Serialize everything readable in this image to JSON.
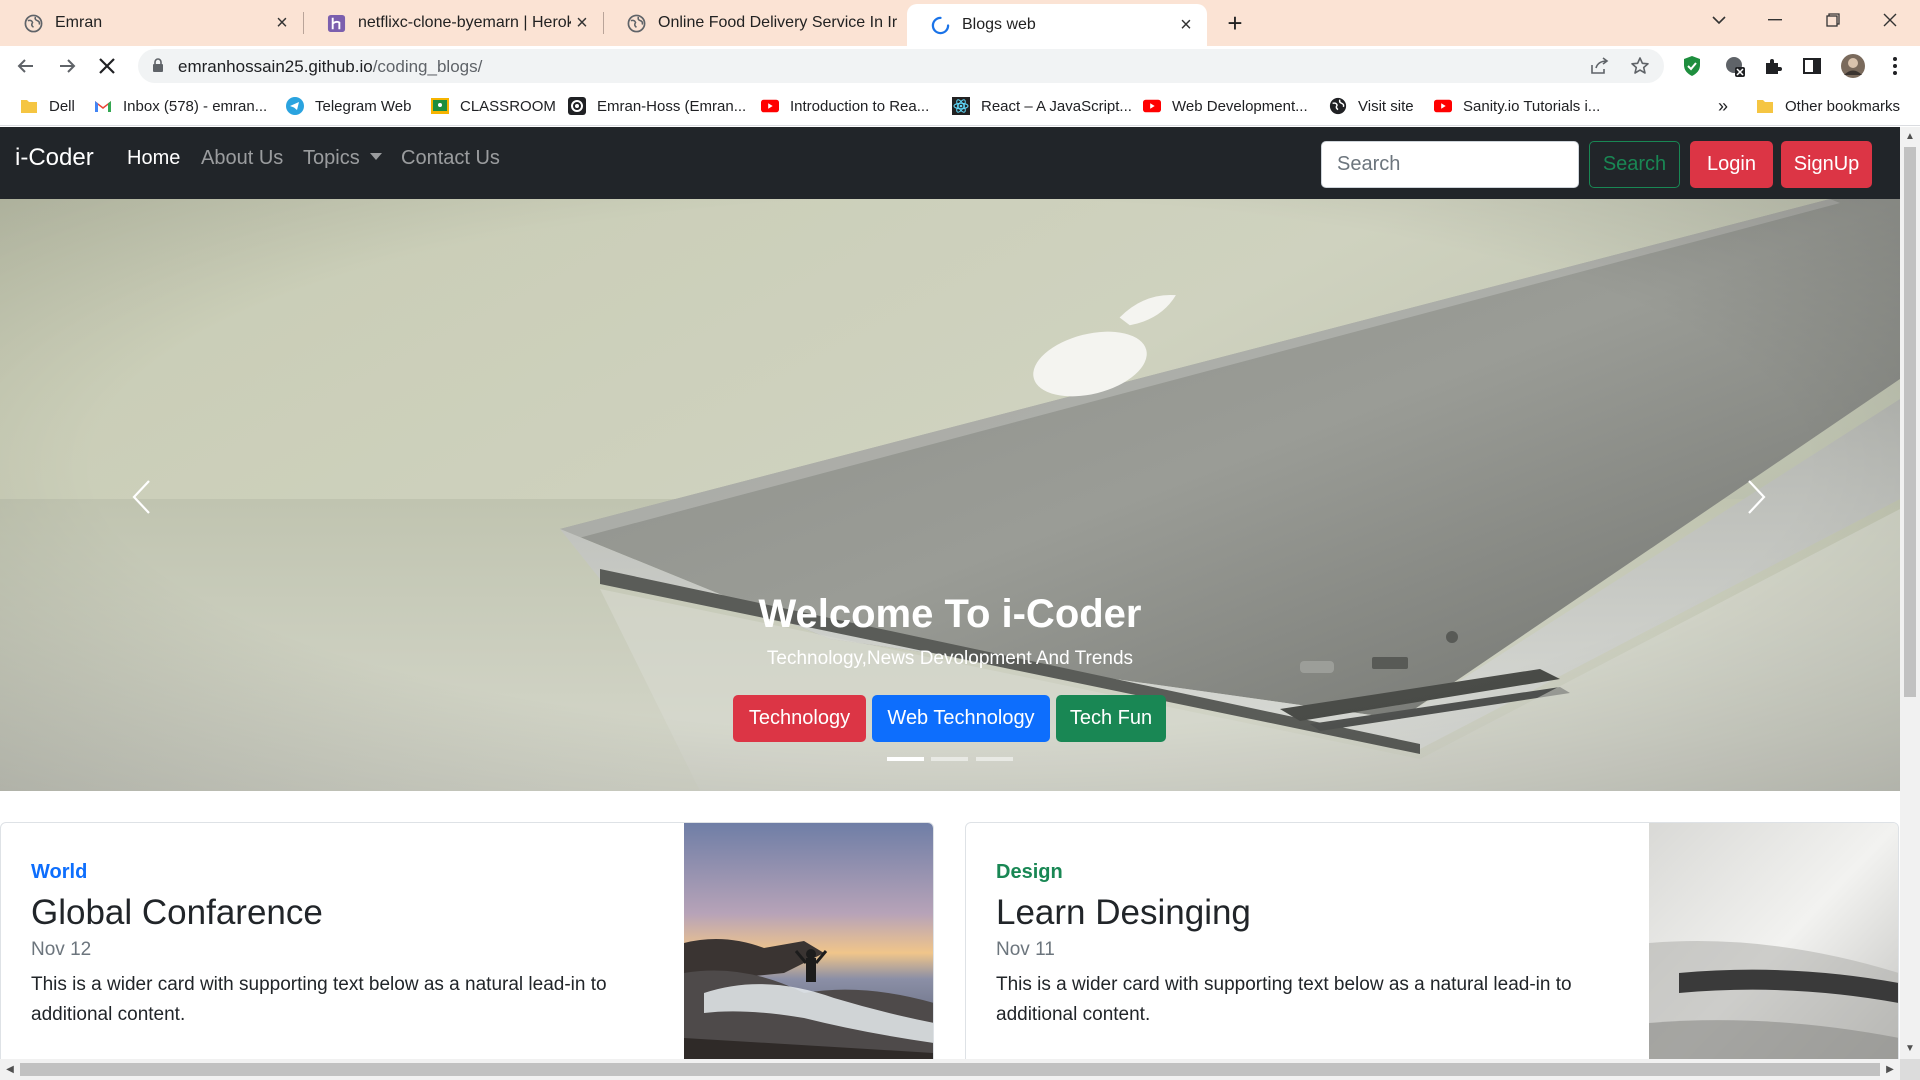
{
  "browser": {
    "tabs": [
      {
        "title": "Emran",
        "active": false
      },
      {
        "title": "netflixc-clone-byemarn | Heroku",
        "active": false
      },
      {
        "title": "Online Food Delivery Service In Ir",
        "active": false
      },
      {
        "title": "Blogs web",
        "active": true
      }
    ],
    "url_host": "emranhossain25.github.io",
    "url_path": "/coding_blogs/",
    "bookmarks": [
      {
        "label": "Dell",
        "icon": "folder-icon"
      },
      {
        "label": "Inbox (578) - emran...",
        "icon": "gmail-icon"
      },
      {
        "label": "Telegram Web",
        "icon": "telegram-icon"
      },
      {
        "label": "CLASSROOM",
        "icon": "classroom-icon"
      },
      {
        "label": "Emran-Hoss (Emran...",
        "icon": "github-icon"
      },
      {
        "label": "Introduction to Rea...",
        "icon": "youtube-icon"
      },
      {
        "label": "React – A JavaScript...",
        "icon": "react-icon"
      },
      {
        "label": "Web Development...",
        "icon": "youtube-icon"
      },
      {
        "label": "Visit site",
        "icon": "globe-icon"
      },
      {
        "label": "Sanity.io Tutorials i...",
        "icon": "youtube-icon"
      }
    ],
    "more_bookmarks": "»",
    "other_bookmarks": "Other bookmarks"
  },
  "site": {
    "brand": "i-Coder",
    "nav": [
      {
        "label": "Home",
        "active": true
      },
      {
        "label": "About Us",
        "active": false
      },
      {
        "label": "Topics",
        "active": false
      },
      {
        "label": "Contact Us",
        "active": false
      }
    ],
    "search_placeholder": "Search",
    "search_button": "Search",
    "login_button": "Login",
    "signup_button": "SignUp",
    "colors": {
      "danger": "#dc3545",
      "primary": "#0d6efd",
      "success": "#198754",
      "navbar": "#212529"
    }
  },
  "carousel": {
    "title": "Welcome To i-Coder",
    "subtitle": "Technology,News Devolopment And Trends",
    "buttons": [
      {
        "label": "Technology",
        "color": "#dc3545"
      },
      {
        "label": "Web Technology",
        "color": "#0d6efd"
      },
      {
        "label": "Tech Fun",
        "color": "#198754"
      }
    ],
    "slide_count": 3,
    "active_slide": 1
  },
  "cards": [
    {
      "category": "World",
      "category_color": "#0d6efd",
      "title": "Global Confarence",
      "date": "Nov 12",
      "text": "This is a wider card with supporting text below as a natural lead-in to additional content."
    },
    {
      "category": "Design",
      "category_color": "#198754",
      "title": "Learn Desinging",
      "date": "Nov 11",
      "text": "This is a wider card with supporting text below as a natural lead-in to additional content."
    }
  ]
}
